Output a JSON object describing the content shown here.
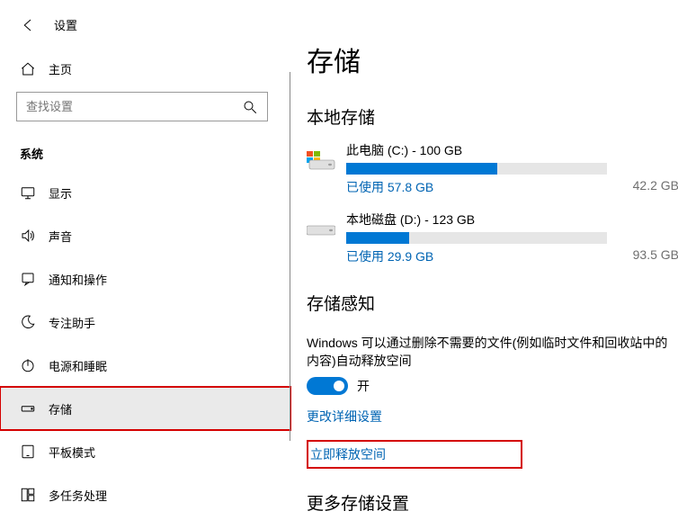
{
  "app_title": "设置",
  "sidebar": {
    "home_label": "主页",
    "search_placeholder": "查找设置",
    "category": "系统",
    "items": [
      {
        "label": "显示"
      },
      {
        "label": "声音"
      },
      {
        "label": "通知和操作"
      },
      {
        "label": "专注助手"
      },
      {
        "label": "电源和睡眠"
      },
      {
        "label": "存储"
      },
      {
        "label": "平板模式"
      },
      {
        "label": "多任务处理"
      }
    ]
  },
  "main": {
    "page_title": "存储",
    "local_storage_header": "本地存储",
    "drives": [
      {
        "title": "此电脑 (C:) - 100 GB",
        "used_label": "已使用 57.8 GB",
        "free_label": "42.2 GB",
        "fill_pct": 58,
        "is_system": true
      },
      {
        "title": "本地磁盘 (D:) - 123 GB",
        "used_label": "已使用 29.9 GB",
        "free_label": "93.5 GB",
        "fill_pct": 24,
        "is_system": false
      }
    ],
    "sense_header": "存储感知",
    "sense_desc": "Windows 可以通过删除不需要的文件(例如临时文件和回收站中的内容)自动释放空间",
    "toggle_label": "开",
    "link_more": "更改详细设置",
    "link_free": "立即释放空间",
    "more_settings_header": "更多存储设置"
  }
}
